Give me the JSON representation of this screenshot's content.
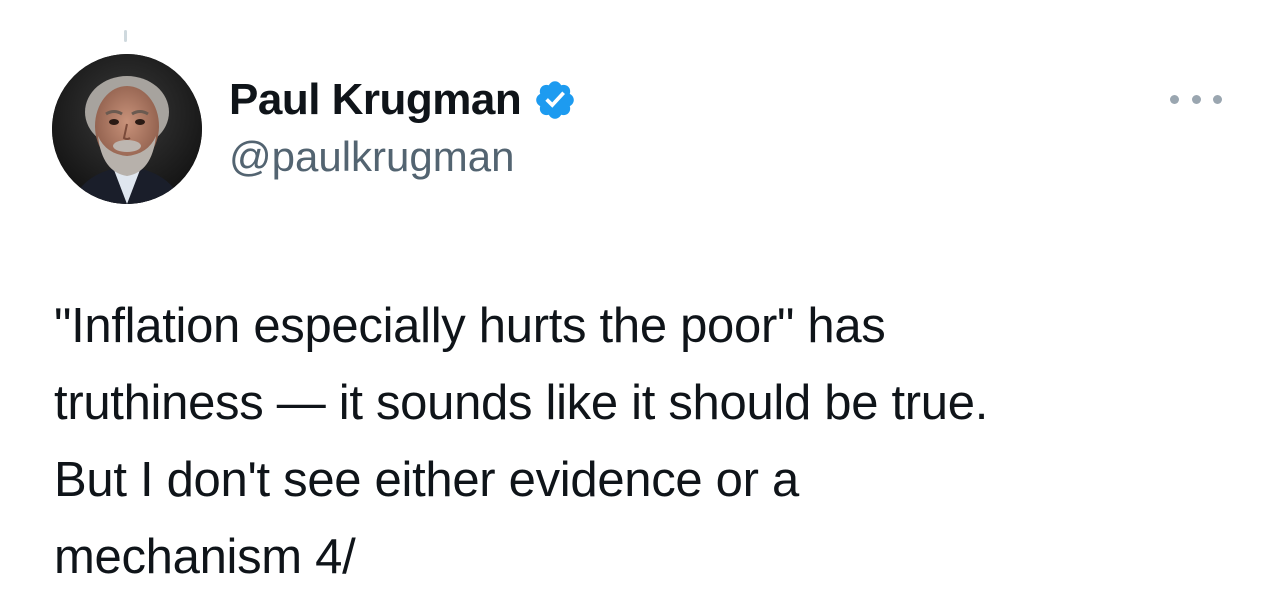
{
  "author": {
    "display_name": "Paul Krugman",
    "handle": "@paulkrugman",
    "verified": true,
    "verified_color": "#1d9bf0",
    "avatar_icon": "profile-photo"
  },
  "menu": {
    "more_icon": "more-options-icon"
  },
  "tweet": {
    "lines": [
      "\"Inflation especially hurts the poor\" has",
      "truthiness — it sounds like it should be true.",
      "But I don't see either evidence or a",
      "mechanism 4/"
    ]
  },
  "colors": {
    "text_primary": "#0f1419",
    "text_secondary": "#536471",
    "background": "#ffffff"
  }
}
